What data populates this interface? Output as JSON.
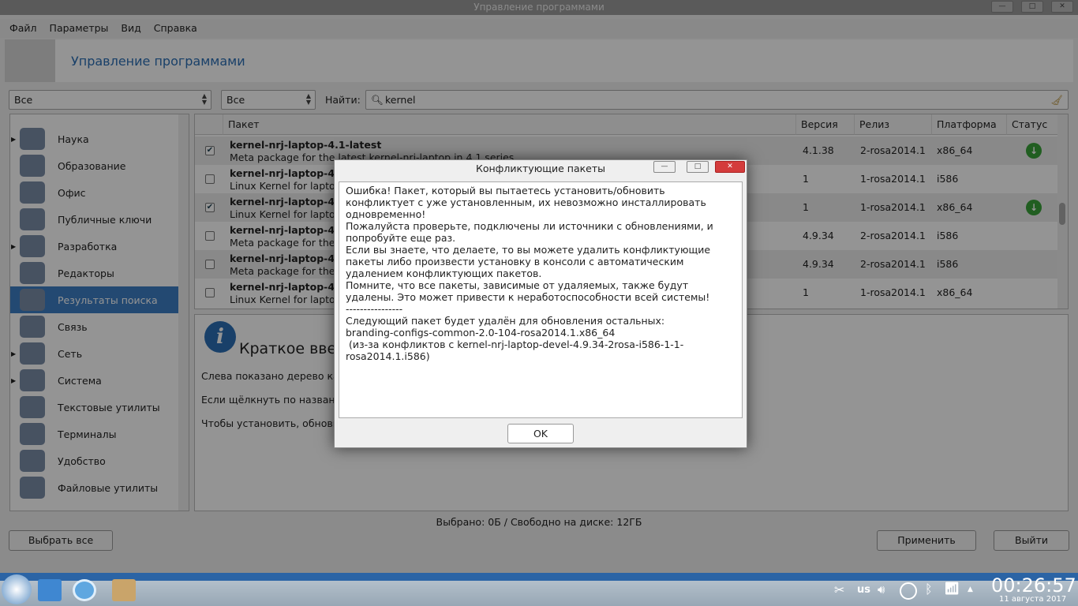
{
  "window": {
    "title": "Управление программами"
  },
  "menu": [
    "Файл",
    "Параметры",
    "Вид",
    "Справка"
  ],
  "header": {
    "title": "Управление программами"
  },
  "filters": {
    "group": "Все",
    "status": "Все",
    "find_label": "Найти:",
    "search_value": "kernel"
  },
  "sidebar": [
    {
      "label": "Наука",
      "expander": true
    },
    {
      "label": "Образование"
    },
    {
      "label": "Офис"
    },
    {
      "label": "Публичные ключи"
    },
    {
      "label": "Разработка",
      "expander": true
    },
    {
      "label": "Редакторы"
    },
    {
      "label": "Результаты поиска",
      "selected": true
    },
    {
      "label": "Связь"
    },
    {
      "label": "Сеть",
      "expander": true
    },
    {
      "label": "Система",
      "expander": true
    },
    {
      "label": "Текстовые утилиты"
    },
    {
      "label": "Терминалы"
    },
    {
      "label": "Удобство"
    },
    {
      "label": "Файловые утилиты"
    }
  ],
  "table": {
    "columns": [
      "Пакет",
      "Версия",
      "Релиз",
      "Платформа",
      "Статус"
    ],
    "rows": [
      {
        "checked": true,
        "name": "kernel-nrj-laptop-4.1-latest",
        "desc": "Meta package for the latest kernel-nrj-laptop in 4.1 series",
        "version": "4.1.38",
        "release": "2-rosa2014.1",
        "arch": "x86_64",
        "installed": true
      },
      {
        "checked": false,
        "name": "kernel-nrj-laptop-4.1.",
        "desc": "Linux Kernel for laptop",
        "version": "1",
        "release": "1-rosa2014.1",
        "arch": "i586",
        "installed": false
      },
      {
        "checked": true,
        "name": "kernel-nrj-laptop-4.1.",
        "desc": "Linux Kernel for laptop",
        "version": "1",
        "release": "1-rosa2014.1",
        "arch": "x86_64",
        "installed": true
      },
      {
        "checked": false,
        "name": "kernel-nrj-laptop-4.9-",
        "desc": "Meta package for the la",
        "version": "4.9.34",
        "release": "2-rosa2014.1",
        "arch": "i586",
        "installed": false
      },
      {
        "checked": false,
        "name": "kernel-nrj-laptop-4.9-",
        "desc": "Meta package for the la",
        "version": "4.9.34",
        "release": "2-rosa2014.1",
        "arch": "i586",
        "installed": false
      },
      {
        "checked": false,
        "name": "kernel-nrj-laptop-4.9.",
        "desc": "Linux Kernel for laptop",
        "version": "1",
        "release": "1-rosa2014.1",
        "arch": "x86_64",
        "installed": false
      }
    ]
  },
  "info": {
    "title": "Краткое введ",
    "lines": [
      "Слева показано дерево кате",
      "Если щёлкнуть по названию",
      "Чтобы установить, обновит"
    ]
  },
  "status": "Выбрано: 0Б / Свободно на диске: 12ГБ",
  "buttons": {
    "select_all": "Выбрать все",
    "apply": "Применить",
    "quit": "Выйти"
  },
  "dialog": {
    "title": "Конфликтующие пакеты",
    "text": "Ошибка! Пакет, который вы пытаетесь установить/обновить конфликтует с уже установленным, их невозможно инсталлировать одновременно!\nПожалуйста проверьте, подключены ли источники с обновлениями, и попробуйте еще раз.\nЕсли вы знаете, что делаете, то вы можете удалить конфликтующие пакеты либо произвести установку в консоли с автоматическим удалением конфликтующих пакетов.\nПомните, что все пакеты, зависимые от удаляемых, также будут удалены. Это может привести к неработоспособности всей системы!\n----------------\nСледующий пакет будет удалён для обновления остальных:\nbranding-configs-common-2.0-104-rosa2014.1.x86_64\n (из-за конфликтов с kernel-nrj-laptop-devel-4.9.34-2rosa-i586-1-1-rosa2014.1.i586)",
    "ok": "OK"
  },
  "tray": {
    "layout": "us",
    "time": "00:26:57",
    "date": "11 августа 2017"
  }
}
